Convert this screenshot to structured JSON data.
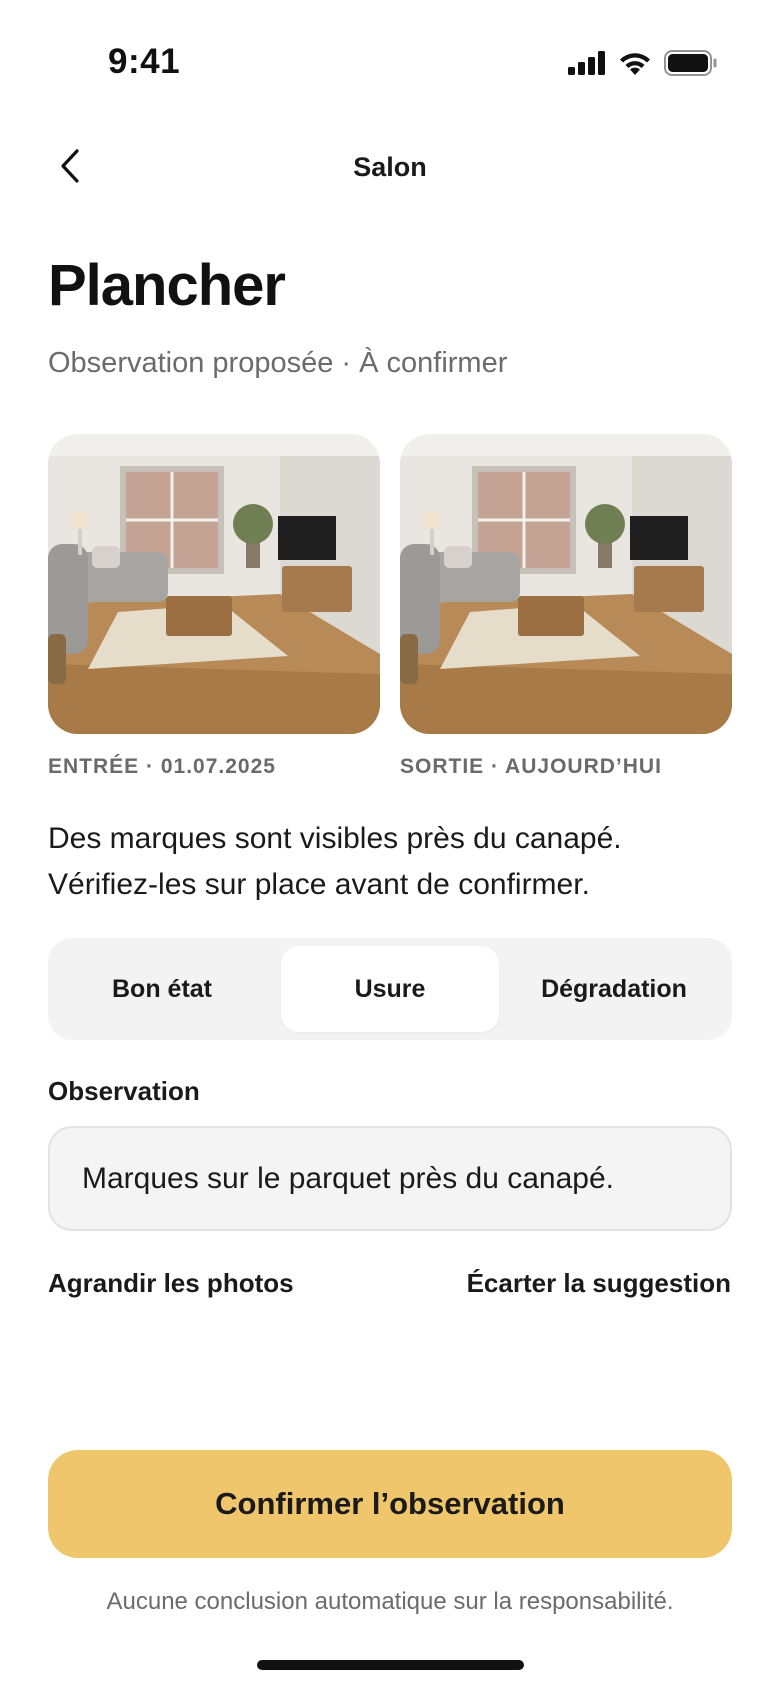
{
  "status_bar": {
    "time": "9:41",
    "icons": [
      "signal-icon",
      "wifi-icon",
      "battery-icon"
    ]
  },
  "nav": {
    "back_icon": "chevron-left-icon",
    "title": "Salon"
  },
  "header": {
    "title": "Plancher",
    "subtitle": "Observation proposée · À confirmer"
  },
  "photos": [
    {
      "caption": "ENTRÉE · 01.07.2025"
    },
    {
      "caption": "SORTIE · AUJOURD’HUI"
    }
  ],
  "description": "Des marques sont visibles près du canapé. Vérifiez-les sur place avant de confirmer.",
  "condition_selector": {
    "options": [
      "Bon état",
      "Usure",
      "Dégradation"
    ],
    "selected": "Usure"
  },
  "observation": {
    "label": "Observation",
    "value": "Marques sur le parquet près du canapé."
  },
  "actions": {
    "enlarge_label": "Agrandir les photos",
    "dismiss_label": "Écarter la suggestion",
    "confirm_label": "Confirmer l’observation"
  },
  "footnote": "Aucune conclusion automatique sur la responsabilité.",
  "colors": {
    "accent": "#f0c66c",
    "segment_background": "#f3f3f3",
    "field_background": "#f4f4f4",
    "secondary_text": "#6b6b6b"
  }
}
